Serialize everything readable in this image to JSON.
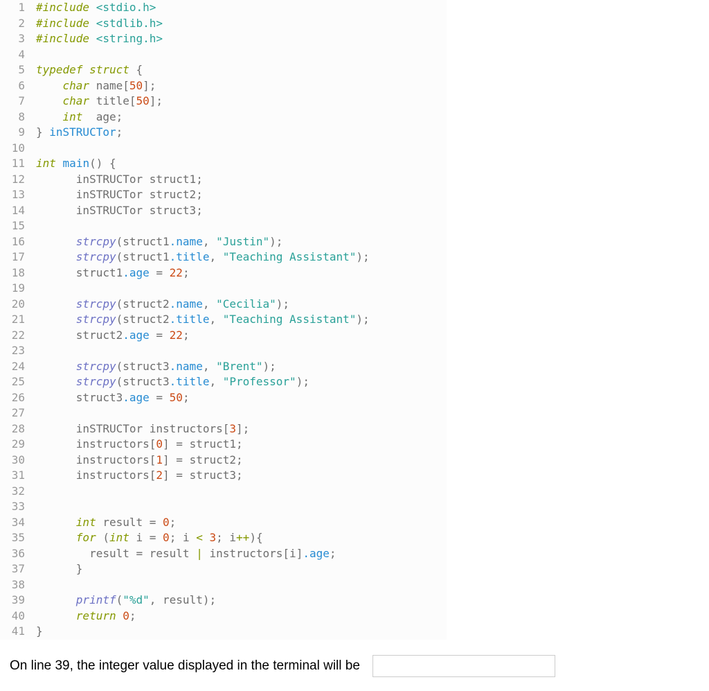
{
  "lineCount": 41,
  "question": "On line 39, the integer value displayed in the terminal will be",
  "answer": "",
  "code": {
    "lines": [
      [
        {
          "c": "tok-preproc",
          "t": "#include "
        },
        {
          "c": "tok-anglestr",
          "t": "<stdio.h>"
        }
      ],
      [
        {
          "c": "tok-preproc",
          "t": "#include "
        },
        {
          "c": "tok-anglestr",
          "t": "<stdlib.h>"
        }
      ],
      [
        {
          "c": "tok-preproc",
          "t": "#include "
        },
        {
          "c": "tok-anglestr",
          "t": "<string.h>"
        }
      ],
      [],
      [
        {
          "c": "tok-keyword",
          "t": "typedef struct"
        },
        {
          "c": "tok-punct",
          "t": " {"
        }
      ],
      [
        {
          "c": "tok-punct",
          "t": "    "
        },
        {
          "c": "tok-type",
          "t": "char"
        },
        {
          "c": "tok-ident",
          "t": " name"
        },
        {
          "c": "tok-punct",
          "t": "["
        },
        {
          "c": "tok-number",
          "t": "50"
        },
        {
          "c": "tok-punct",
          "t": "];"
        }
      ],
      [
        {
          "c": "tok-punct",
          "t": "    "
        },
        {
          "c": "tok-type",
          "t": "char"
        },
        {
          "c": "tok-ident",
          "t": " title"
        },
        {
          "c": "tok-punct",
          "t": "["
        },
        {
          "c": "tok-number",
          "t": "50"
        },
        {
          "c": "tok-punct",
          "t": "];"
        }
      ],
      [
        {
          "c": "tok-punct",
          "t": "    "
        },
        {
          "c": "tok-type",
          "t": "int"
        },
        {
          "c": "tok-ident",
          "t": "  age"
        },
        {
          "c": "tok-punct",
          "t": ";"
        }
      ],
      [
        {
          "c": "tok-punct",
          "t": "} "
        },
        {
          "c": "tok-typedefnm",
          "t": "inSTRUCTor"
        },
        {
          "c": "tok-punct",
          "t": ";"
        }
      ],
      [],
      [
        {
          "c": "tok-type",
          "t": "int"
        },
        {
          "c": "tok-punct",
          "t": " "
        },
        {
          "c": "tok-func",
          "t": "main"
        },
        {
          "c": "tok-punct",
          "t": "() {"
        }
      ],
      [
        {
          "c": "tok-punct",
          "t": "      inSTRUCTor struct1;"
        }
      ],
      [
        {
          "c": "tok-punct",
          "t": "      inSTRUCTor struct2;"
        }
      ],
      [
        {
          "c": "tok-punct",
          "t": "      inSTRUCTor struct3;"
        }
      ],
      [],
      [
        {
          "c": "tok-punct",
          "t": "      "
        },
        {
          "c": "tok-call",
          "t": "strcpy"
        },
        {
          "c": "tok-punct",
          "t": "(struct1"
        },
        {
          "c": "tok-member",
          "t": ".name"
        },
        {
          "c": "tok-punct",
          "t": ", "
        },
        {
          "c": "tok-string",
          "t": "\"Justin\""
        },
        {
          "c": "tok-punct",
          "t": ");"
        }
      ],
      [
        {
          "c": "tok-punct",
          "t": "      "
        },
        {
          "c": "tok-call",
          "t": "strcpy"
        },
        {
          "c": "tok-punct",
          "t": "(struct1"
        },
        {
          "c": "tok-member",
          "t": ".title"
        },
        {
          "c": "tok-punct",
          "t": ", "
        },
        {
          "c": "tok-string",
          "t": "\"Teaching Assistant\""
        },
        {
          "c": "tok-punct",
          "t": ");"
        }
      ],
      [
        {
          "c": "tok-punct",
          "t": "      struct1"
        },
        {
          "c": "tok-member",
          "t": ".age"
        },
        {
          "c": "tok-punct",
          "t": " = "
        },
        {
          "c": "tok-number",
          "t": "22"
        },
        {
          "c": "tok-punct",
          "t": ";"
        }
      ],
      [],
      [
        {
          "c": "tok-punct",
          "t": "      "
        },
        {
          "c": "tok-call",
          "t": "strcpy"
        },
        {
          "c": "tok-punct",
          "t": "(struct2"
        },
        {
          "c": "tok-member",
          "t": ".name"
        },
        {
          "c": "tok-punct",
          "t": ", "
        },
        {
          "c": "tok-string",
          "t": "\"Cecilia\""
        },
        {
          "c": "tok-punct",
          "t": ");"
        }
      ],
      [
        {
          "c": "tok-punct",
          "t": "      "
        },
        {
          "c": "tok-call",
          "t": "strcpy"
        },
        {
          "c": "tok-punct",
          "t": "(struct2"
        },
        {
          "c": "tok-member",
          "t": ".title"
        },
        {
          "c": "tok-punct",
          "t": ", "
        },
        {
          "c": "tok-string",
          "t": "\"Teaching Assistant\""
        },
        {
          "c": "tok-punct",
          "t": ");"
        }
      ],
      [
        {
          "c": "tok-punct",
          "t": "      struct2"
        },
        {
          "c": "tok-member",
          "t": ".age"
        },
        {
          "c": "tok-punct",
          "t": " = "
        },
        {
          "c": "tok-number",
          "t": "22"
        },
        {
          "c": "tok-punct",
          "t": ";"
        }
      ],
      [],
      [
        {
          "c": "tok-punct",
          "t": "      "
        },
        {
          "c": "tok-call",
          "t": "strcpy"
        },
        {
          "c": "tok-punct",
          "t": "(struct3"
        },
        {
          "c": "tok-member",
          "t": ".name"
        },
        {
          "c": "tok-punct",
          "t": ", "
        },
        {
          "c": "tok-string",
          "t": "\"Brent\""
        },
        {
          "c": "tok-punct",
          "t": ");"
        }
      ],
      [
        {
          "c": "tok-punct",
          "t": "      "
        },
        {
          "c": "tok-call",
          "t": "strcpy"
        },
        {
          "c": "tok-punct",
          "t": "(struct3"
        },
        {
          "c": "tok-member",
          "t": ".title"
        },
        {
          "c": "tok-punct",
          "t": ", "
        },
        {
          "c": "tok-string",
          "t": "\"Professor\""
        },
        {
          "c": "tok-punct",
          "t": ");"
        }
      ],
      [
        {
          "c": "tok-punct",
          "t": "      struct3"
        },
        {
          "c": "tok-member",
          "t": ".age"
        },
        {
          "c": "tok-punct",
          "t": " = "
        },
        {
          "c": "tok-number",
          "t": "50"
        },
        {
          "c": "tok-punct",
          "t": ";"
        }
      ],
      [],
      [
        {
          "c": "tok-punct",
          "t": "      inSTRUCTor instructors["
        },
        {
          "c": "tok-number",
          "t": "3"
        },
        {
          "c": "tok-punct",
          "t": "];"
        }
      ],
      [
        {
          "c": "tok-punct",
          "t": "      instructors["
        },
        {
          "c": "tok-number",
          "t": "0"
        },
        {
          "c": "tok-punct",
          "t": "] = struct1;"
        }
      ],
      [
        {
          "c": "tok-punct",
          "t": "      instructors["
        },
        {
          "c": "tok-number",
          "t": "1"
        },
        {
          "c": "tok-punct",
          "t": "] = struct2;"
        }
      ],
      [
        {
          "c": "tok-punct",
          "t": "      instructors["
        },
        {
          "c": "tok-number",
          "t": "2"
        },
        {
          "c": "tok-punct",
          "t": "] = struct3;"
        }
      ],
      [],
      [],
      [
        {
          "c": "tok-punct",
          "t": "      "
        },
        {
          "c": "tok-type",
          "t": "int"
        },
        {
          "c": "tok-punct",
          "t": " result = "
        },
        {
          "c": "tok-number",
          "t": "0"
        },
        {
          "c": "tok-punct",
          "t": ";"
        }
      ],
      [
        {
          "c": "tok-punct",
          "t": "      "
        },
        {
          "c": "tok-keyword",
          "t": "for"
        },
        {
          "c": "tok-punct",
          "t": " ("
        },
        {
          "c": "tok-type",
          "t": "int"
        },
        {
          "c": "tok-punct",
          "t": " i = "
        },
        {
          "c": "tok-number",
          "t": "0"
        },
        {
          "c": "tok-punct",
          "t": "; i "
        },
        {
          "c": "tok-op",
          "t": "<"
        },
        {
          "c": "tok-punct",
          "t": " "
        },
        {
          "c": "tok-number",
          "t": "3"
        },
        {
          "c": "tok-punct",
          "t": "; i"
        },
        {
          "c": "tok-op",
          "t": "++"
        },
        {
          "c": "tok-punct",
          "t": "){"
        }
      ],
      [
        {
          "c": "tok-punct",
          "t": "        result = result "
        },
        {
          "c": "tok-op",
          "t": "|"
        },
        {
          "c": "tok-punct",
          "t": " instructors[i]"
        },
        {
          "c": "tok-member",
          "t": ".age"
        },
        {
          "c": "tok-punct",
          "t": ";"
        }
      ],
      [
        {
          "c": "tok-punct",
          "t": "      }"
        }
      ],
      [],
      [
        {
          "c": "tok-punct",
          "t": "      "
        },
        {
          "c": "tok-call",
          "t": "printf"
        },
        {
          "c": "tok-punct",
          "t": "("
        },
        {
          "c": "tok-string",
          "t": "\"%d\""
        },
        {
          "c": "tok-punct",
          "t": ", result);"
        }
      ],
      [
        {
          "c": "tok-punct",
          "t": "      "
        },
        {
          "c": "tok-keyword",
          "t": "return"
        },
        {
          "c": "tok-punct",
          "t": " "
        },
        {
          "c": "tok-number",
          "t": "0"
        },
        {
          "c": "tok-punct",
          "t": ";"
        }
      ],
      [
        {
          "c": "tok-punct",
          "t": "}"
        }
      ]
    ]
  }
}
